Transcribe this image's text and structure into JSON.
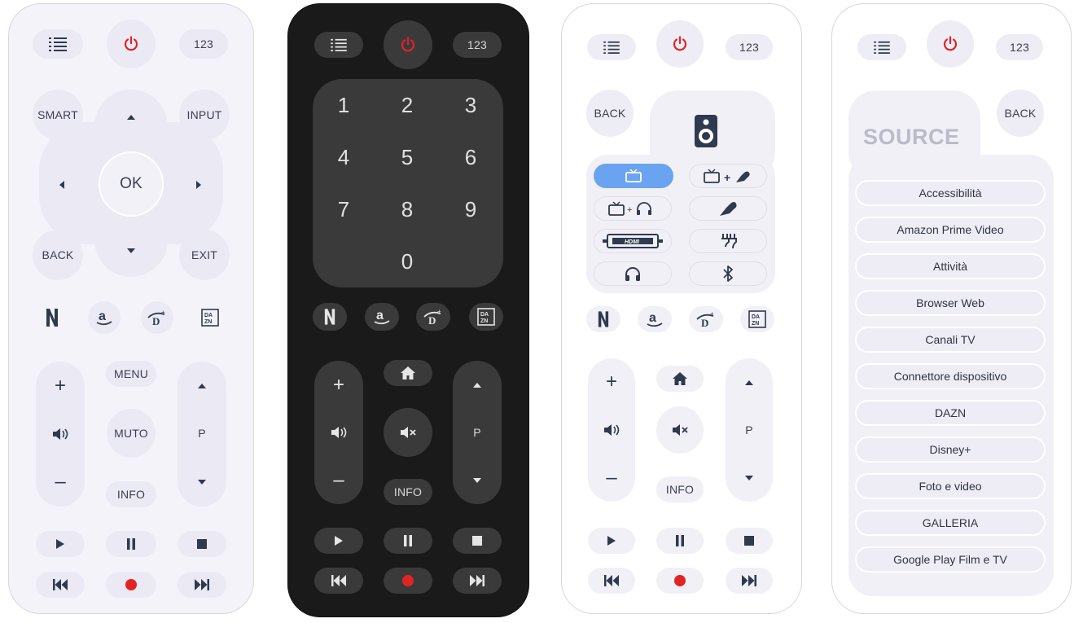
{
  "common": {
    "num_label": "123",
    "smart": "SMART",
    "input": "INPUT",
    "ok": "OK",
    "back": "BACK",
    "exit": "EXIT",
    "menu": "MENU",
    "muto": "MUTO",
    "info": "INFO",
    "p": "P"
  },
  "numpad": [
    "1",
    "2",
    "3",
    "4",
    "5",
    "6",
    "7",
    "8",
    "9",
    "0"
  ],
  "apps": [
    "netflix-icon",
    "amazon-icon",
    "disney-icon",
    "dazn-icon"
  ],
  "dazn_text": "DA ZN",
  "source": {
    "title": "SOURCE",
    "back": "BACK",
    "items": [
      "Accessibilità",
      "Amazon Prime Video",
      "Attività",
      "Browser Web",
      "Canali TV",
      "Connettore dispositivo",
      "DAZN",
      "Disney+",
      "Foto e video",
      "GALLERIA",
      "Google Play Film e TV"
    ]
  },
  "colors": {
    "power": "#e02424",
    "record": "#e02424",
    "accent": "#6aa3f0",
    "light_bg": "#f4f3fa",
    "dark_bg": "#1a1a1a"
  }
}
